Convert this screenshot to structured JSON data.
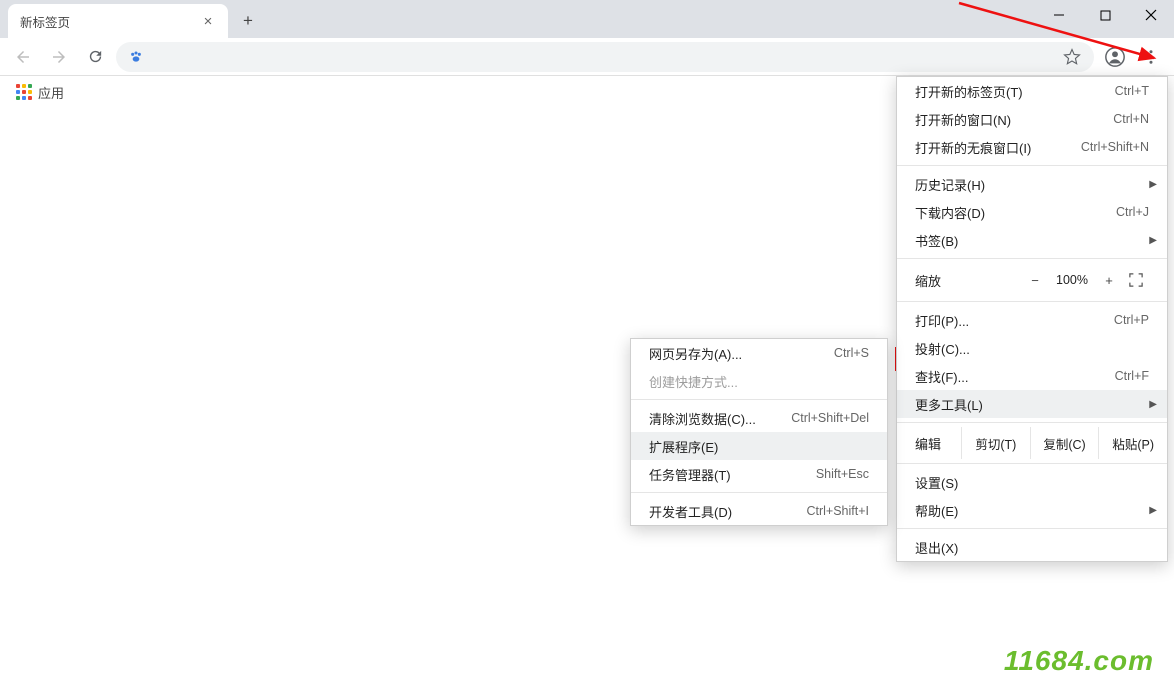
{
  "tab": {
    "title": "新标签页"
  },
  "bookmarks": {
    "apps_label": "应用"
  },
  "apps_colors": [
    "#EA4335",
    "#FBBC05",
    "#34A853",
    "#4285F4",
    "#EA4335",
    "#FBBC05",
    "#34A853",
    "#4285F4",
    "#EA4335"
  ],
  "omnibox": {
    "placeholder": ""
  },
  "menu": {
    "new_tab": {
      "label": "打开新的标签页(T)",
      "shortcut": "Ctrl+T"
    },
    "new_window": {
      "label": "打开新的窗口(N)",
      "shortcut": "Ctrl+N"
    },
    "new_incognito": {
      "label": "打开新的无痕窗口(I)",
      "shortcut": "Ctrl+Shift+N"
    },
    "history": {
      "label": "历史记录(H)"
    },
    "downloads": {
      "label": "下载内容(D)",
      "shortcut": "Ctrl+J"
    },
    "bookmarks": {
      "label": "书签(B)"
    },
    "zoom": {
      "label": "缩放",
      "minus": "−",
      "pct": "100%",
      "plus": "+"
    },
    "print": {
      "label": "打印(P)...",
      "shortcut": "Ctrl+P"
    },
    "cast": {
      "label": "投射(C)..."
    },
    "find": {
      "label": "查找(F)...",
      "shortcut": "Ctrl+F"
    },
    "more_tools": {
      "label": "更多工具(L)"
    },
    "edit": {
      "label": "编辑",
      "cut": "剪切(T)",
      "copy": "复制(C)",
      "paste": "粘贴(P)"
    },
    "settings": {
      "label": "设置(S)"
    },
    "help": {
      "label": "帮助(E)"
    },
    "exit": {
      "label": "退出(X)"
    }
  },
  "submenu": {
    "save_as": {
      "label": "网页另存为(A)...",
      "shortcut": "Ctrl+S"
    },
    "create_shortcut": {
      "label": "创建快捷方式..."
    },
    "clear_data": {
      "label": "清除浏览数据(C)...",
      "shortcut": "Ctrl+Shift+Del"
    },
    "extensions": {
      "label": "扩展程序(E)"
    },
    "task_manager": {
      "label": "任务管理器(T)",
      "shortcut": "Shift+Esc"
    },
    "dev_tools": {
      "label": "开发者工具(D)",
      "shortcut": "Ctrl+Shift+I"
    }
  },
  "watermark": "11684.com"
}
